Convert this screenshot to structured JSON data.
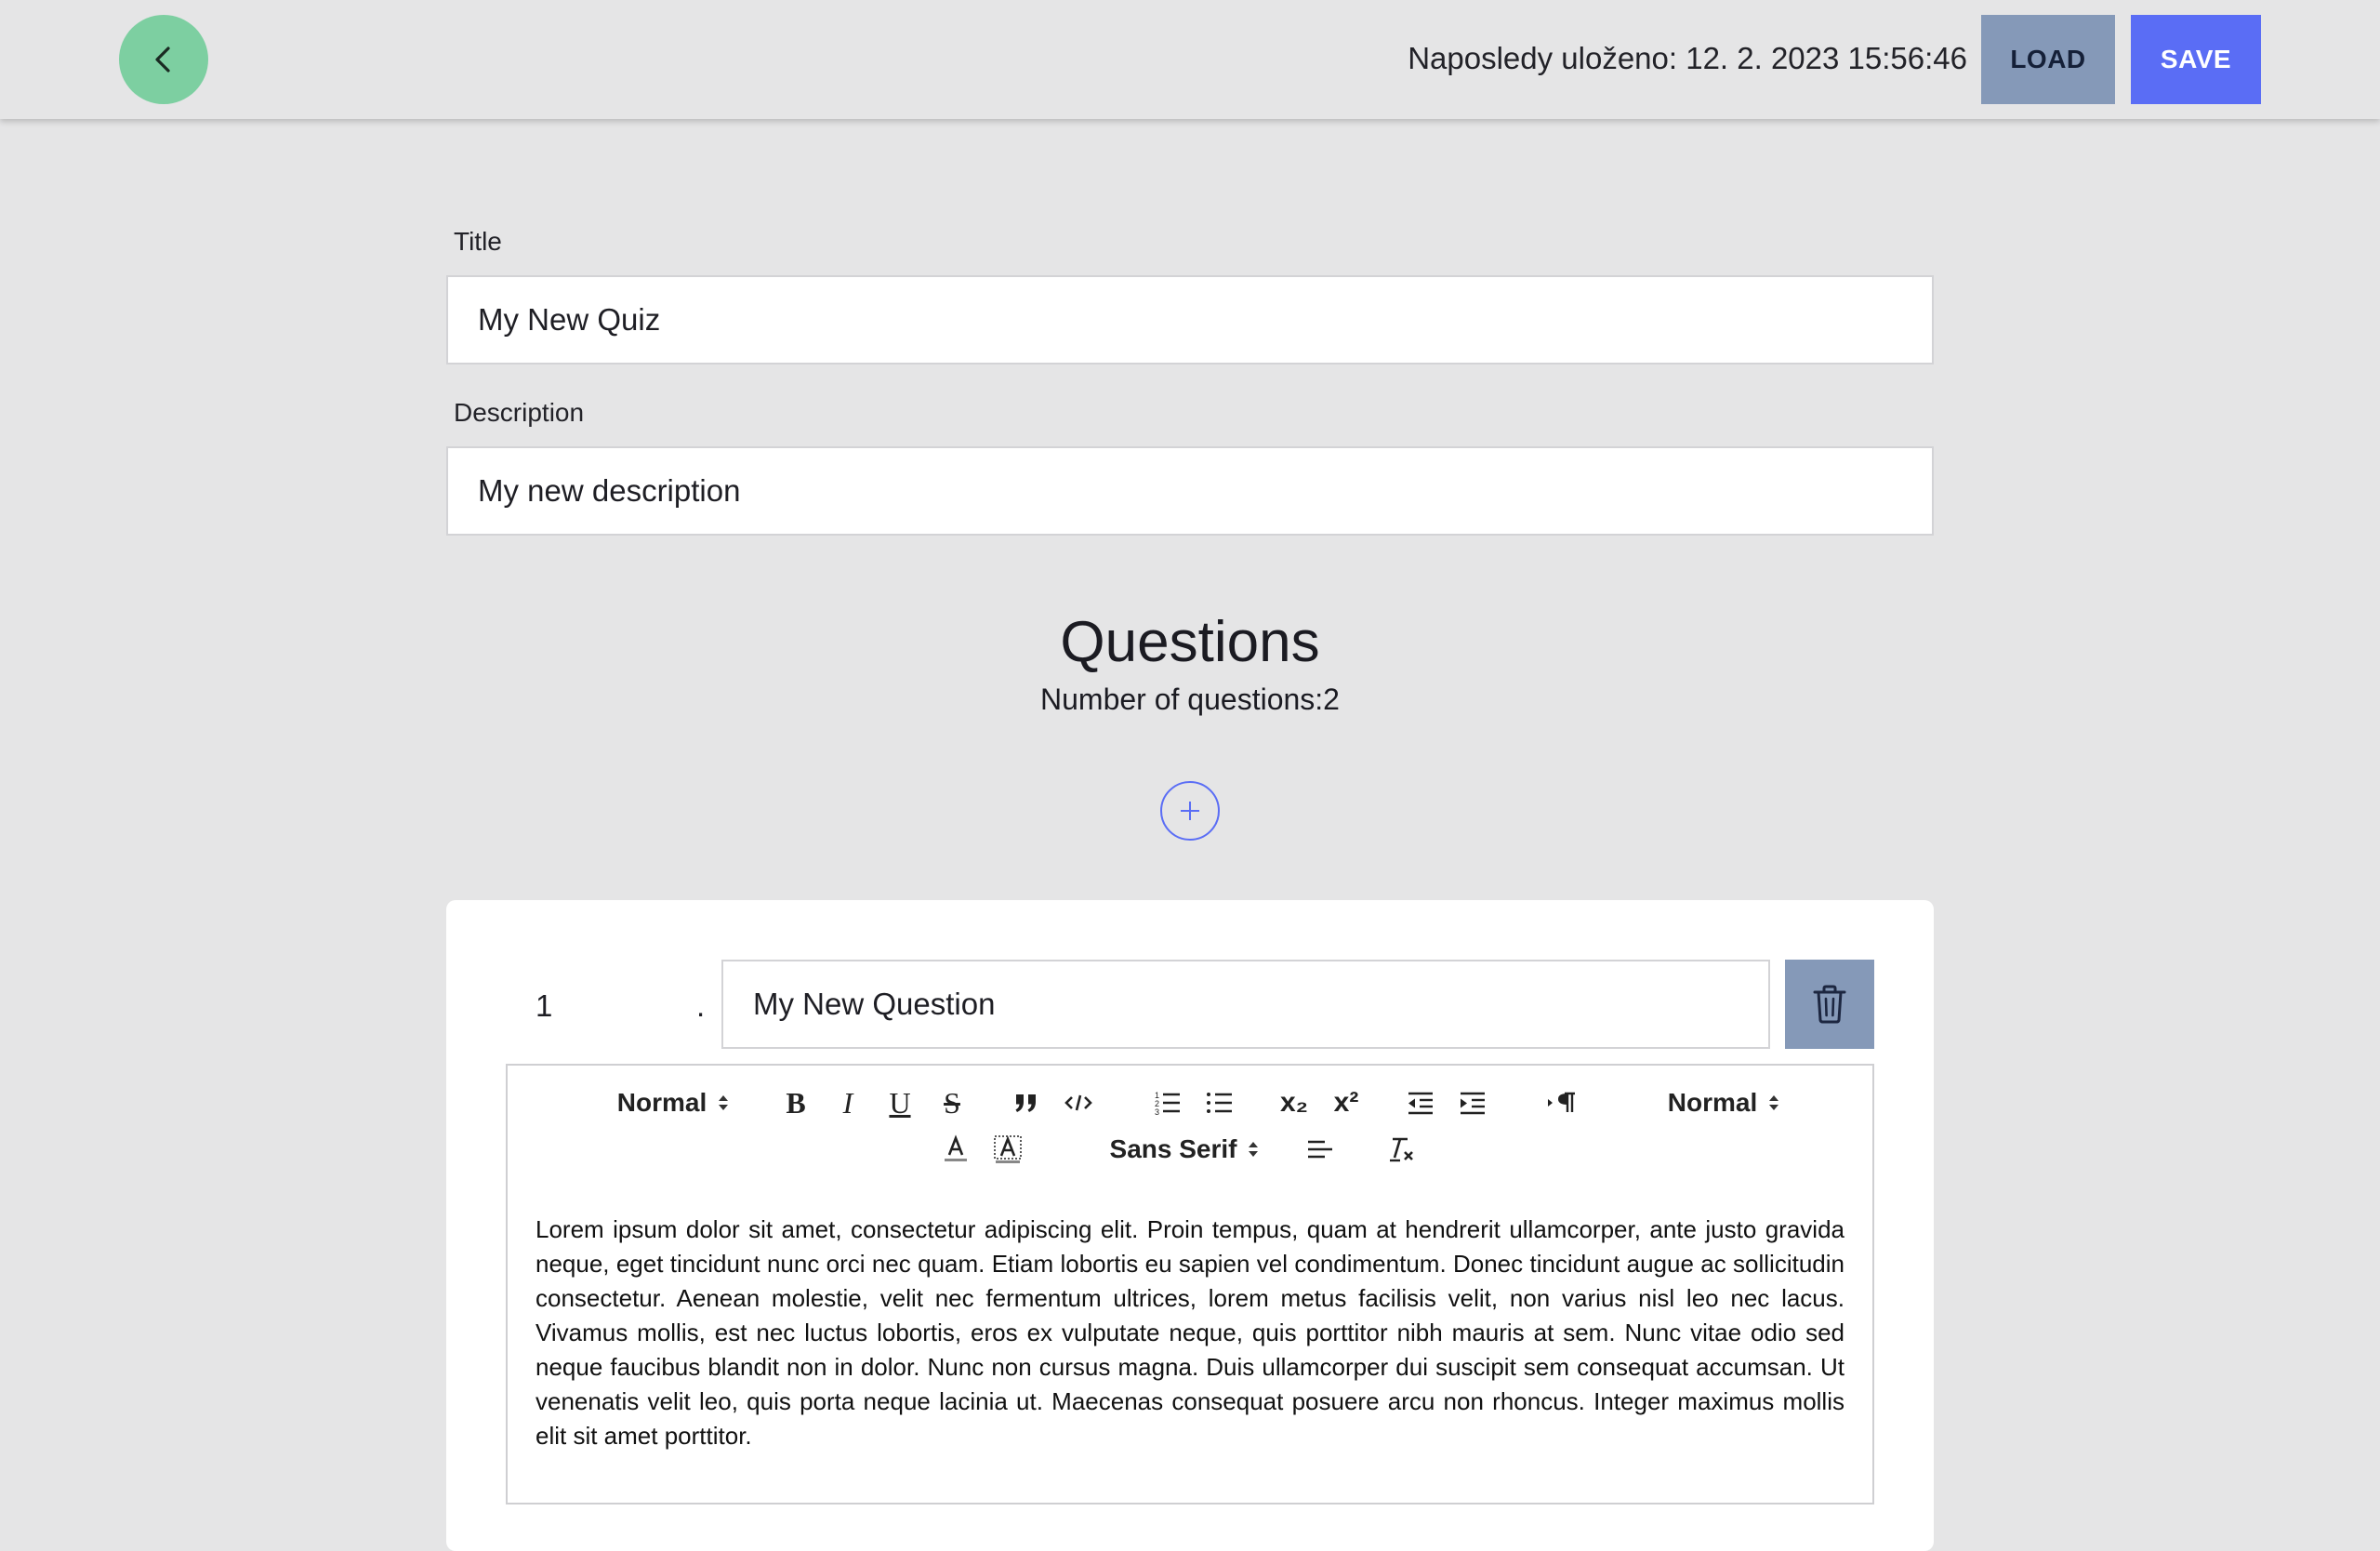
{
  "header": {
    "last_saved": "Naposledy uloženo: 12. 2. 2023 15:56:46",
    "load_label": "LOAD",
    "save_label": "SAVE"
  },
  "form": {
    "title_label": "Title",
    "title_value": "My New Quiz",
    "description_label": "Description",
    "description_value": "My new description"
  },
  "questions": {
    "heading": "Questions",
    "count_text": "Number of questions:2",
    "items": [
      {
        "number": "1",
        "separator": ".",
        "title": "My New Question",
        "body": "Lorem ipsum dolor sit amet, consectetur adipiscing elit. Proin tempus, quam at hendrerit ullamcorper, ante justo gravida neque, eget tincidunt nunc orci nec quam. Etiam lobortis eu sapien vel condimentum. Donec tincidunt augue ac sollicitudin consectetur. Aenean molestie, velit nec fermentum ultrices, lorem metus facilisis velit, non varius nisl leo nec lacus. Vivamus mollis, est nec luctus lobortis, eros ex vulputate neque, quis porttitor nibh mauris at sem. Nunc vitae odio sed neque faucibus blandit non in dolor. Nunc non cursus magna. Duis ullamcorper dui suscipit sem consequat accumsan. Ut venenatis velit leo, quis porta neque lacinia ut. Maecenas consequat posuere arcu non rhoncus. Integer maximus mollis elit sit amet porttitor."
      }
    ]
  },
  "toolbar": {
    "header_picker": "Normal",
    "size_picker": "Normal",
    "font_picker": "Sans Serif",
    "bold_glyph": "B",
    "italic_glyph": "I",
    "underline_glyph": "U",
    "strike_glyph": "S",
    "subscript_glyph": "x₂",
    "superscript_glyph": "x²"
  },
  "colors": {
    "background": "#e5e5e6",
    "back_button": "#7dcfa1",
    "load_button": "#8599b8",
    "save_button": "#5a6df5",
    "delete_button": "#8599b8",
    "add_button_outline": "#5a6df5"
  },
  "icons": {
    "back": "chevron-left-icon",
    "add": "plus-icon",
    "delete": "trash-icon"
  }
}
